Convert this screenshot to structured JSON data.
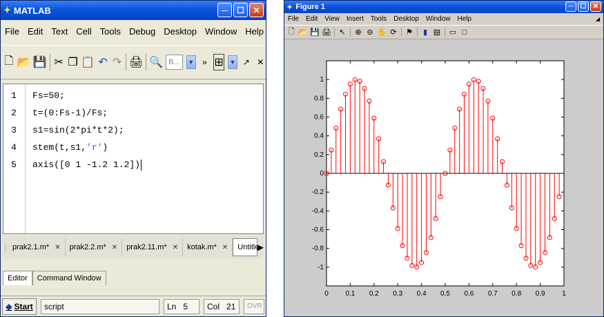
{
  "matlab": {
    "title": "MATLAB",
    "menu": [
      "File",
      "Edit",
      "Text",
      "Cell",
      "Tools",
      "Debug",
      "Desktop",
      "Window",
      "Help"
    ],
    "stack_dropdown": "B...",
    "code_lines": [
      {
        "num": "1",
        "text": "Fs=50;"
      },
      {
        "num": "2",
        "text": "t=(0:Fs-1)/Fs;"
      },
      {
        "num": "3",
        "text": "s1=sin(2*pi*t*2);"
      },
      {
        "num": "4",
        "text_before": "stem(t,s1,",
        "str": "'r'",
        "text_after": ")"
      },
      {
        "num": "5",
        "text": "axis([0 1 -1.2 1.2])"
      }
    ],
    "doc_tabs": [
      "prak2.1.m*",
      "prak2.2.m*",
      "prak2.11.m*",
      "kotak.m*",
      "Untitled"
    ],
    "panel_tabs": [
      "Editor",
      "Command Window"
    ],
    "status": {
      "start": "Start",
      "mode": "script",
      "ln_label": "Ln",
      "ln": "5",
      "col_label": "Col",
      "col": "21",
      "ovr": "OVR"
    }
  },
  "figure": {
    "title": "Figure 1",
    "menu": [
      "File",
      "Edit",
      "View",
      "Insert",
      "Tools",
      "Desktop",
      "Window",
      "Help"
    ]
  },
  "chart_data": {
    "type": "stem",
    "title": "",
    "xlabel": "",
    "ylabel": "",
    "xlim": [
      0,
      1
    ],
    "ylim": [
      -1.2,
      1.2
    ],
    "color": "#ff0000",
    "xticks": [
      "0",
      "0.1",
      "0.2",
      "0.3",
      "0.4",
      "0.5",
      "0.6",
      "0.7",
      "0.8",
      "0.9",
      "1"
    ],
    "yticks": [
      "-1",
      "-0.8",
      "-0.6",
      "-0.4",
      "-0.2",
      "0",
      "0.2",
      "0.4",
      "0.6",
      "0.8",
      "1"
    ],
    "x": [
      0,
      0.02,
      0.04,
      0.06,
      0.08,
      0.1,
      0.12,
      0.14,
      0.16,
      0.18,
      0.2,
      0.22,
      0.24,
      0.26,
      0.28,
      0.3,
      0.32,
      0.34,
      0.36,
      0.38,
      0.4,
      0.42,
      0.44,
      0.46,
      0.48,
      0.5,
      0.52,
      0.54,
      0.56,
      0.58,
      0.6,
      0.62,
      0.64,
      0.66,
      0.68,
      0.7,
      0.72,
      0.74,
      0.76,
      0.78,
      0.8,
      0.82,
      0.84,
      0.86,
      0.88,
      0.9,
      0.92,
      0.94,
      0.96,
      0.98
    ],
    "y": [
      0,
      0.2487,
      0.4818,
      0.6845,
      0.8443,
      0.9511,
      0.998,
      0.9823,
      0.9048,
      0.7705,
      0.5878,
      0.3681,
      0.1253,
      -0.1253,
      -0.3681,
      -0.5878,
      -0.7705,
      -0.9048,
      -0.9823,
      -0.998,
      -0.9511,
      -0.8443,
      -0.6845,
      -0.4818,
      -0.2487,
      0,
      0.2487,
      0.4818,
      0.6845,
      0.8443,
      0.9511,
      0.998,
      0.9823,
      0.9048,
      0.7705,
      0.5878,
      0.3681,
      0.1253,
      -0.1253,
      -0.3681,
      -0.5878,
      -0.7705,
      -0.9048,
      -0.9823,
      -0.998,
      -0.9511,
      -0.8443,
      -0.6845,
      -0.4818,
      -0.2487
    ]
  }
}
